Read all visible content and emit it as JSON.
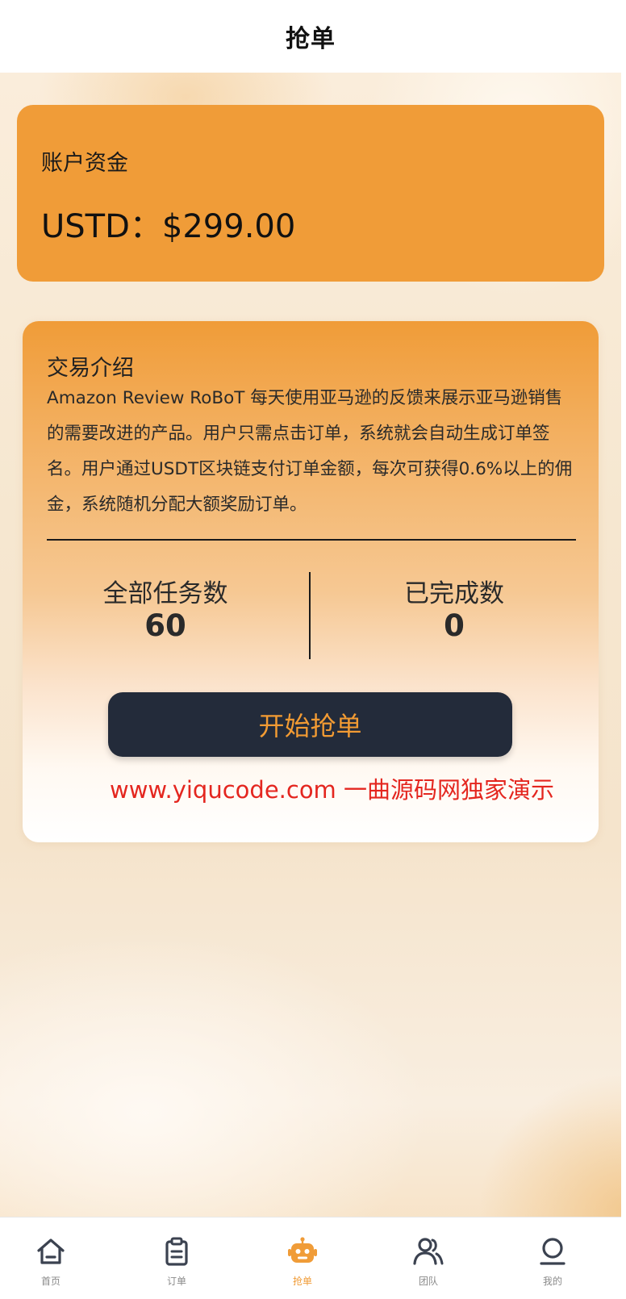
{
  "header": {
    "title": "抢单"
  },
  "account": {
    "label": "账户资金",
    "balance": "USTD：$299.00"
  },
  "trade": {
    "intro_title": "交易介绍",
    "intro_text": "Amazon Review RoBoT 每天使用亚马逊的反馈来展示亚马逊销售的需要改进的产品。用户只需点击订单，系统就会自动生成订单签名。用户通过USDT区块链支付订单金额，每次可获得0.6%以上的佣金，系统随机分配大额奖励订单。",
    "total_tasks_label": "全部任务数",
    "total_tasks_value": "60",
    "completed_label": "已完成数",
    "completed_value": "0",
    "start_button": "开始抢单",
    "watermark": "www.yiqucode.com 一曲源码网独家演示"
  },
  "tabbar": {
    "active": "抢单",
    "items": [
      {
        "label": "首页",
        "icon": "home-icon"
      },
      {
        "label": "订单",
        "icon": "clipboard-icon"
      },
      {
        "label": "抢单",
        "icon": "robot-icon"
      },
      {
        "label": "团队",
        "icon": "users-icon"
      },
      {
        "label": "我的",
        "icon": "user-icon"
      }
    ]
  },
  "colors": {
    "accent": "#f09c38",
    "button_bg": "#232b3a",
    "watermark": "#e4261f",
    "tab_inactive": "#8a8a8a"
  }
}
